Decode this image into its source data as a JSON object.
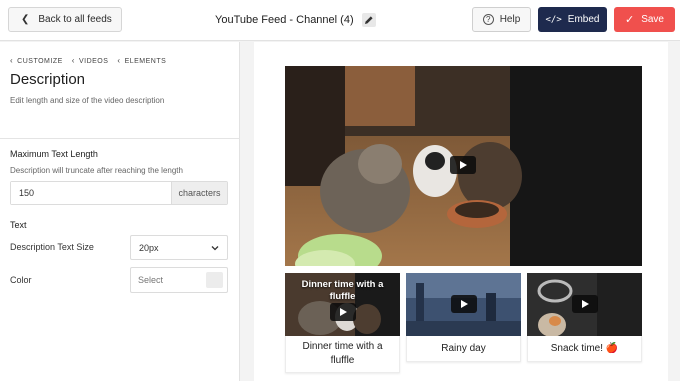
{
  "topbar": {
    "back_label": "Back to all feeds",
    "feed_title": "YouTube Feed - Channel (4)",
    "help_label": "Help",
    "embed_label": "Embed",
    "save_label": "Save"
  },
  "sidebar": {
    "breadcrumb": [
      "CUSTOMIZE",
      "VIDEOS",
      "ELEMENTS"
    ],
    "title": "Description",
    "description": "Edit length and size of the video description",
    "max_length": {
      "label": "Maximum Text Length",
      "help": "Description will truncate after reaching the length",
      "value": "150",
      "unit": "characters"
    },
    "text_section": {
      "label": "Text",
      "size_label": "Description Text Size",
      "size_value": "20px",
      "color_label": "Color",
      "color_placeholder": "Select"
    }
  },
  "preview": {
    "videos": [
      {
        "overlay_title": "Dinner time with a fluffle",
        "caption": "Dinner time with a fluffle"
      },
      {
        "overlay_title": "",
        "caption": "Rainy day"
      },
      {
        "overlay_title": "",
        "caption": "Snack time! 🍎"
      }
    ]
  },
  "colors": {
    "embed": "#1e2a4e",
    "save": "#f0504d"
  }
}
